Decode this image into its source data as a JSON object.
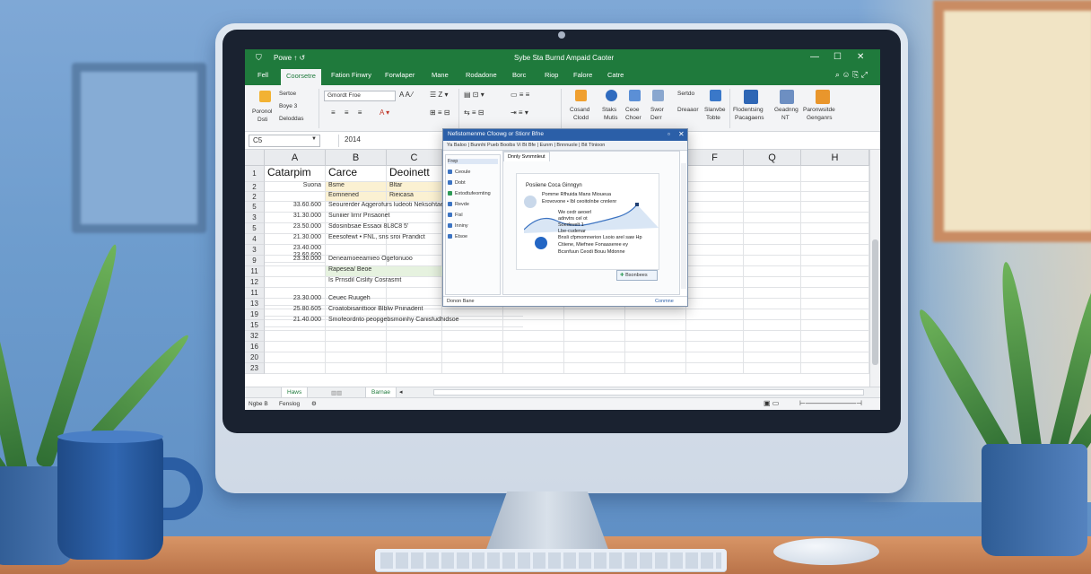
{
  "excel": {
    "title": {
      "qa_text": "Powe ↑ ↺",
      "doc_title": "Sybe Sta Burnd Ampaid Caoter",
      "minimize": "—",
      "restore": "☐",
      "close": "✕"
    },
    "tabs": [
      "Fell",
      "Coorsetre",
      "Fation Finwry",
      "Forwlaper",
      "Mane",
      "Rodadone",
      "Borc",
      "Riop",
      "Falore",
      "Catre"
    ],
    "tab_icons": "⌕ ☺ ⎘ ⤢",
    "ribbon": {
      "paste_top": "Poronol",
      "paste_bottom": "Dsti",
      "clip_items": [
        "Sertoe",
        "Boye 3",
        "Deloddas"
      ],
      "font_name": "Gmordt Froe",
      "groups": [
        {
          "label": "Cosand",
          "label2": "Clodd"
        },
        {
          "label": "Staks",
          "label2": "Mutis"
        },
        {
          "label": "Ceoe",
          "label2": "Choer"
        },
        {
          "label": "Swor",
          "label2": "Derr"
        },
        {
          "label": "Sertdo",
          "label2": "Dreaaor"
        },
        {
          "label": "Slanvbe",
          "label2": "Tobte"
        },
        {
          "label": "Flodentsing",
          "label2": "Pacagaens"
        },
        {
          "label": "Geadnng",
          "label2": "NT"
        },
        {
          "label": "Paronwsitde",
          "label2": "Genganrs"
        }
      ]
    },
    "formula_bar": {
      "name_box": "C5",
      "formula": "2014"
    },
    "columns": [
      "A",
      "B",
      "C",
      "",
      "",
      "",
      "",
      "F",
      "Q",
      "H"
    ],
    "rows": [
      "1",
      "2",
      "2",
      "5",
      "3",
      "5",
      "4",
      "3",
      "9",
      "11",
      "12",
      "11",
      "13",
      "19",
      "15",
      "32",
      "16",
      "20",
      "23"
    ],
    "cells": {
      "a1": "Catarpim",
      "b1": "Carce",
      "c1": "Deoinett",
      "a2": "Suona",
      "b2": "Bsme",
      "b3": "Eomnened",
      "c2": "Bltar",
      "c3": "Rieicasa",
      "a_dates": [
        "33.60.600",
        "31.30.000",
        "23.50.000",
        "21.30.000",
        "23.40.000",
        "23.30.000",
        "23.60.600"
      ],
      "b_texts": [
        "Seourerder Aqgerofurs ludeoti Neksohtaes",
        "Suniiier lirnr Pnsaonet",
        "Sdosinbsae Essaoi 8L8C8 5'",
        "Eeesofewt • FNL, sns sroi Prandict",
        "",
        "Deneamoeeamieo Ogefonuoo",
        "Rapesea/ Beoe",
        "Is Prnsdil Cislity Cosrasmt"
      ],
      "b_hl": "Rapesea/ Beoe",
      "a11": "23.30.000",
      "a12": "25.80.605",
      "a13": "21.40.000",
      "b12": "Ceuec Ruugeh",
      "b13": "Croatobisanttioor Blblw Pninadent",
      "b14": "Smofeordnto peopgebsmoinhy Canisfudhidsoe"
    },
    "sheets": [
      "Haws",
      "Barnae"
    ],
    "status": {
      "left": "Ngbe B",
      "mid": "Fenslog",
      "icon": "⚙"
    },
    "dialog": {
      "title": "Nefistomenme Cfoowg or Sticnr Bfne",
      "toolbar": "Ya Baloo | Bunnhi Pueb Booibs Vi Bt Bfe | Eunm | Bnnnuole | Bit Ttnioon",
      "nav": [
        "Frep",
        "Ceoule",
        "Dobt",
        "Extodtufeomting",
        "Revde",
        "Fisl",
        "Inniny",
        "Etsoe"
      ],
      "tab": "Dnnly Svnmnleut",
      "card_title": "Posiiene Coca Ginngyn",
      "card_sub": "Pomme Rfhuida Mans Mioueua",
      "card_sub2": "Erovovone • Ibl ceoitolnbe cnnlenr",
      "card_lines": [
        "We cedr aeoerl",
        "adnvtrs cel ot",
        "Soedsvelt 1",
        "Lbe-cudenar",
        "Bnsli cfpmomnerion Lsoio arel saw Hp",
        "Ctiiene, Miefnee Fonaaseree ey",
        "Bcsnfuun Ceodi Bouu Mdonne"
      ],
      "button": "Bsonbees",
      "foot_left": "Donon Bane",
      "foot_right": "Conmne"
    }
  }
}
